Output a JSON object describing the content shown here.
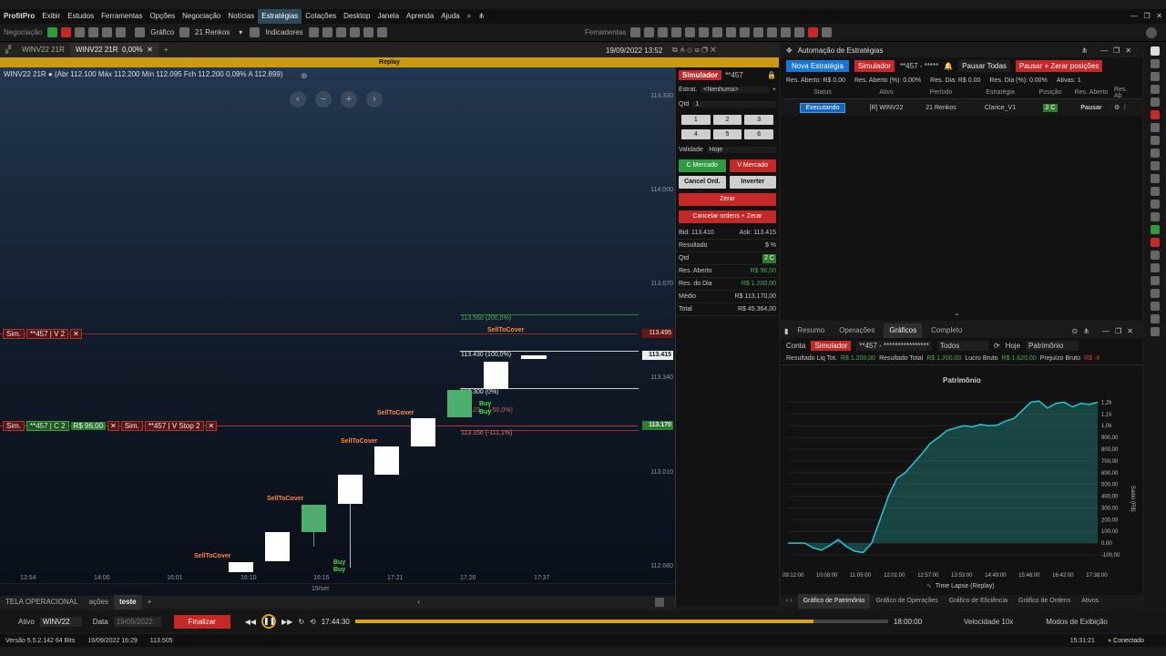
{
  "menu": {
    "app": "ProfitPro",
    "items": [
      "Exibir",
      "Estudos",
      "Ferramentas",
      "Opções",
      "Negociação",
      "Notícias",
      "Estratégias",
      "Cotações",
      "Desktop",
      "Janela",
      "Aprenda",
      "Ajuda"
    ]
  },
  "toolbar": {
    "negociacao": "Negociação",
    "grafico": "Gráfico",
    "renkos": "21 Renkos",
    "indicadores": "Indicadores",
    "ferramentas": "Ferramentas"
  },
  "tabs": [
    {
      "label": "WINV22 21R"
    },
    {
      "label": "WINV22 21R",
      "pct": "0,00%"
    }
  ],
  "datetime": "19/09/2022 13:52",
  "replay": "Replay",
  "chart": {
    "ohlc": "WINV22 21R ● (Abr 112.100 Máx 112.200 Mín 112.095 Fch 112.200 0,09% A 112.899)",
    "y_ticks": [
      "114.330",
      "114.000",
      "113.670",
      "113.340",
      "113.010",
      "112.680"
    ],
    "x_ticks": [
      "13:54",
      "14:00",
      "16:01",
      "16:10",
      "16:15",
      "17:21",
      "17:26",
      "17:37"
    ],
    "date": "19/set",
    "last_price": "113.495",
    "price_now": "113.415",
    "price_avg": "113.170",
    "sim_label": "Sim.",
    "sim_v2": "**457 | V 2",
    "sim_c2": "**457 | C 2",
    "sim_c2_pnl": "R$ 96,00",
    "sim_vstop": "**457 | V Stop 2",
    "levels": [
      "113.560 (200,0%)",
      "113.430 (100,0%)",
      "113.300 (0%)",
      "113.156 (-111,1%)",
      "113.23..",
      "(-50,0%)"
    ],
    "annotations": [
      "SellToCover",
      "SellToCover",
      "SellToCover",
      "SellToCover",
      "SellToCover",
      "Buy",
      "Buy",
      "Buy",
      "Buy"
    ],
    "candles": [
      {
        "x": 264,
        "top": 617,
        "h": 11,
        "up": false
      },
      {
        "x": 304,
        "top": 584,
        "h": 32,
        "up": false
      },
      {
        "x": 344,
        "top": 554,
        "h": 30,
        "up": true
      },
      {
        "x": 384,
        "top": 521,
        "h": 32,
        "up": false
      },
      {
        "x": 424,
        "top": 490,
        "h": 31,
        "up": false
      },
      {
        "x": 464,
        "top": 459,
        "h": 31,
        "up": false
      },
      {
        "x": 504,
        "top": 428,
        "h": 30,
        "up": true
      },
      {
        "x": 544,
        "top": 397,
        "h": 30,
        "up": false
      }
    ]
  },
  "boleta": {
    "simulador": "Simulador",
    "conta": "**457",
    "estrat_label": "Estrat.",
    "estrat_val": "<Nenhuma>",
    "qtd_label": "Qtd",
    "qtd_val": "1",
    "nums": [
      "1",
      "2",
      "3",
      "4",
      "5",
      "6"
    ],
    "validade_label": "Validade",
    "validade_val": "Hoje",
    "c_mercado": "C Mercado",
    "v_mercado": "V Mercado",
    "cancel_ord": "Cancel Ord.",
    "inverter": "Inverter",
    "zerar": "Zerar",
    "cancelar_zerar": "Cancelar ordens + Zerar",
    "bid_label": "Bid:",
    "bid": "113.410",
    "ask_label": "Ask:",
    "ask": "113.415",
    "resultado": "Resultado",
    "qtd2_label": "Qtd",
    "qtd2": "2 C",
    "res_aberto_label": "Res. Aberto",
    "res_aberto": "R$ 96,00",
    "res_dia_label": "Res. do Dia",
    "res_dia": "R$ 1.200,00",
    "medio_label": "Médio",
    "medio": "R$ 113.170,00",
    "total_label": "Total",
    "total": "R$ 45.364,00"
  },
  "auto": {
    "title": "Automação de Estratégias",
    "nova": "Nova Estratégia",
    "simulador": "Simulador",
    "conta": "**457 - *****",
    "pausar_todas": "Pausar Todas",
    "pausar_zerar": "Pausar + Zerar posições",
    "res_aberto": "Res. Aberto: R$ 0.00",
    "res_aberto_pct": "Res. Aberto (%): 0.00%",
    "res_dia": "Res. Dia: R$ 0.00",
    "res_dia_pct": "Res. Dia (%): 0.00%",
    "ativas": "Ativas: 1",
    "cols": [
      "Status",
      "Ativo",
      "Período",
      "Estratégia",
      "Posição",
      "Res. Aberto",
      "Res. Ab"
    ],
    "row": {
      "status": "Executando",
      "ativo": "[R] WINV22",
      "periodo": "21 Renkos",
      "estrategia": "Clarice_V1",
      "posicao": "2 C",
      "pausar": "Pausar"
    }
  },
  "results": {
    "tabs": [
      "Resumo",
      "Operações",
      "Gráficos",
      "Completo"
    ],
    "conta_label": "Conta",
    "simulador": "Simulador",
    "conta": "**457 - ****************",
    "todos": "Todos",
    "hoje": "Hoje",
    "patrimonio": "Patrimônio",
    "liq_label": "Resultado Liq Tot.",
    "liq": "R$ 1.200,00",
    "total_label": "Resultado Total",
    "total": "R$ 1.200,00",
    "bruto_label": "Lucro Bruto",
    "bruto": "R$ 1.620,00",
    "prej_label": "Prejuízo Bruto",
    "prej": "R$ -4",
    "chart_title": "Patrimônio",
    "ylabel": "Saldo (R$)",
    "legend": "Time Lapse (Replay)",
    "bottom_tabs": [
      "Gráfico de Patrimônio",
      "Gráfico de Operações",
      "Gráfico de Eficiência",
      "Gráfico de Ordens",
      "Ativos"
    ]
  },
  "chart_data": {
    "type": "area",
    "title": "Patrimônio",
    "xlabel": "",
    "ylabel": "Saldo (R$)",
    "x": [
      "09:12:00",
      "10:08:00",
      "11:05:00",
      "12:01:00",
      "12:57:00",
      "13:53:00",
      "14:49:00",
      "15:46:00",
      "16:42:00",
      "17:38:00"
    ],
    "y_ticks": [
      "1,2k",
      "1,1k",
      "1,0k",
      "900,00",
      "800,00",
      "700,00",
      "600,00",
      "500,00",
      "400,00",
      "300,00",
      "200,00",
      "100,00",
      "0,00",
      "-100,00"
    ],
    "ylim": [
      -100,
      1250
    ],
    "values": [
      0,
      0,
      0,
      -40,
      -60,
      -20,
      30,
      -30,
      -70,
      -80,
      0,
      200,
      400,
      550,
      600,
      680,
      760,
      850,
      900,
      960,
      980,
      1000,
      990,
      1010,
      1000,
      1005,
      1040,
      1060,
      1130,
      1200,
      1210,
      1150,
      1190,
      1200,
      1160,
      1190,
      1180,
      1200
    ]
  },
  "sheets": {
    "tabs": [
      "TELA OPERACIONAL",
      "ações",
      "teste"
    ]
  },
  "timeline": {
    "ativo_label": "Ativo",
    "ativo": "WINV22",
    "data_label": "Data",
    "data": "19/09/2022",
    "finalizar": "Finalizar",
    "start": "17:44:30",
    "end": "18:00:00",
    "velocidade": "Velocidade 10x",
    "modos": "Modos de Exibição",
    "progress": 0.86
  },
  "status": {
    "versao": "Versão 5.5.2.142 64 Bits",
    "datetime": "19/09/2022 16:29",
    "price": "113.505",
    "clock": "15:31:21",
    "conexao": "Conectado"
  }
}
